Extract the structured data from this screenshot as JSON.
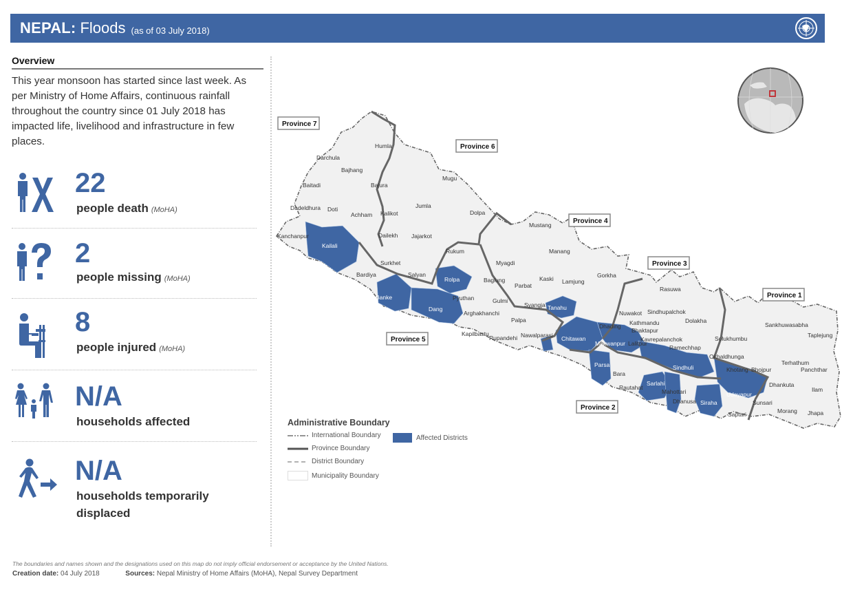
{
  "header": {
    "country": "NEPAL:",
    "event": "Floods",
    "as_of": "(as of 03 July 2018)",
    "logo": "un-emblem-icon"
  },
  "overview": {
    "title": "Overview",
    "text": "This year monsoon has started since last week. As per Ministry of Home Affairs, continuous rainfall throughout the country since 01 July 2018 has impacted life, livelihood and infrastructure in few places."
  },
  "stats": [
    {
      "icon": "person-x-icon",
      "value": "22",
      "label": "people death",
      "source": "(MoHA)"
    },
    {
      "icon": "person-question-icon",
      "value": "2",
      "label": "people missing",
      "source": "(MoHA)"
    },
    {
      "icon": "injured-person-crutch-icon",
      "value": "8",
      "label": "people injured",
      "source": "(MoHA)"
    },
    {
      "icon": "family-icon",
      "value": "N/A",
      "label": "households affected",
      "source": ""
    },
    {
      "icon": "displaced-person-arrow-icon",
      "value": "N/A",
      "label_line1": "households temporarily",
      "label_line2": "displaced",
      "source": ""
    }
  ],
  "map": {
    "provinces": [
      "Province 7",
      "Province 6",
      "Province 5",
      "Province 4",
      "Province 3",
      "Province 2",
      "Province 1"
    ],
    "district_labels": {
      "darchula": "Darchula",
      "bajhang": "Bajhang",
      "baitadi": "Baitadi",
      "bajura": "Bajura",
      "humla": "Humla",
      "mugu": "Mugu",
      "dadeldhura": "Dadeldhura",
      "doti": "Doti",
      "achham": "Achham",
      "kalikot": "Kalikot",
      "jumla": "Jumla",
      "dolpa": "Dolpa",
      "kanchanpur": "Kanchanpur",
      "kailali": "Kailali",
      "dailekh": "Dailekh",
      "jajarkot": "Jajarkot",
      "rukum": "Rukum",
      "surkhet": "Surkhet",
      "bardiya": "Bardiya",
      "salyan": "Salyan",
      "rolpa": "Rolpa",
      "banke": "Banke",
      "dang": "Dang",
      "pyuthan": "Pyuthan",
      "arghakhanchi": "Arghakhanchi",
      "gulmi": "Gulmi",
      "kapilbastu": "Kapilbastu",
      "rupandehi": "Rupandehi",
      "palpa": "Palpa",
      "nawalparasi": "Nawalparasi",
      "mustang": "Mustang",
      "manang": "Manang",
      "myagdi": "Myagdi",
      "baglung": "Baglung",
      "parbat": "Parbat",
      "kaski": "Kaski",
      "lamjung": "Lamjung",
      "gorkha": "Gorkha",
      "syangja": "Syangja",
      "tanahu": "Tanahu",
      "chitawan": "Chitawan",
      "makwanpur": "Makwanpur",
      "dhading": "Dhading",
      "nuwakot": "Nuwakot",
      "rasuwa": "Rasuwa",
      "sindhupalchok": "Sindhupalchok",
      "kathmandu": "Kathmandu",
      "bhaktapur": "Bhaktapur",
      "lalitpur": "Lalitpur",
      "kavrepalanchok": "Kavrepalanchok",
      "dolakha": "Dolakha",
      "ramechhap": "Ramechhap",
      "sindhuli": "Sindhuli",
      "okhaldhunga": "Okhaldhunga",
      "solukhumbu": "Solukhumbu",
      "parsa": "Parsa",
      "bara": "Bara",
      "rautahat": "Rautahat",
      "sarlahi": "Sarlahi",
      "mahottari": "Mahottari",
      "dhanusa": "Dhanusa",
      "siraha": "Siraha",
      "udayapur": "Udayapur",
      "saptari": "Saptari",
      "sunsari": "Sunsari",
      "khotang": "Khotang",
      "bhojpur": "Bhojpur",
      "dhankuta": "Dhankuta",
      "morang": "Morang",
      "jhapa": "Jhapa",
      "ilam": "Ilam",
      "panchthar": "Panchthar",
      "terhathum": "Terhathum",
      "sankhuwasabha": "Sankhuwasabha",
      "taplejung": "Taplejung"
    },
    "affected_districts": [
      "Kailali",
      "Banke",
      "Dang",
      "Rolpa",
      "Tanahu",
      "Chitawan",
      "Makwanpur",
      "Parsa",
      "Sarlahi",
      "Mahottari",
      "Sindhuli",
      "Siraha",
      "Udayapur",
      "Nawalparasi"
    ],
    "affected_color": "#3f66a3",
    "land_color": "#f1f1f1"
  },
  "legend": {
    "title": "Administrative Boundary",
    "items": [
      "International Boundary",
      "Province Boundary",
      "District Boundary",
      "Municipality Boundary"
    ],
    "affected_label": "Affected Districts"
  },
  "footer": {
    "disclaimer": "The boundaries and names shown and the designations used on this map do not imply official endorsement or acceptance by the United Nations.",
    "creation_label": "Creation date:",
    "creation_value": "04 July 2018",
    "sources_label": "Sources:",
    "sources_value": "Nepal Ministry of Home Affairs (MoHA),  Nepal Survey Department"
  }
}
